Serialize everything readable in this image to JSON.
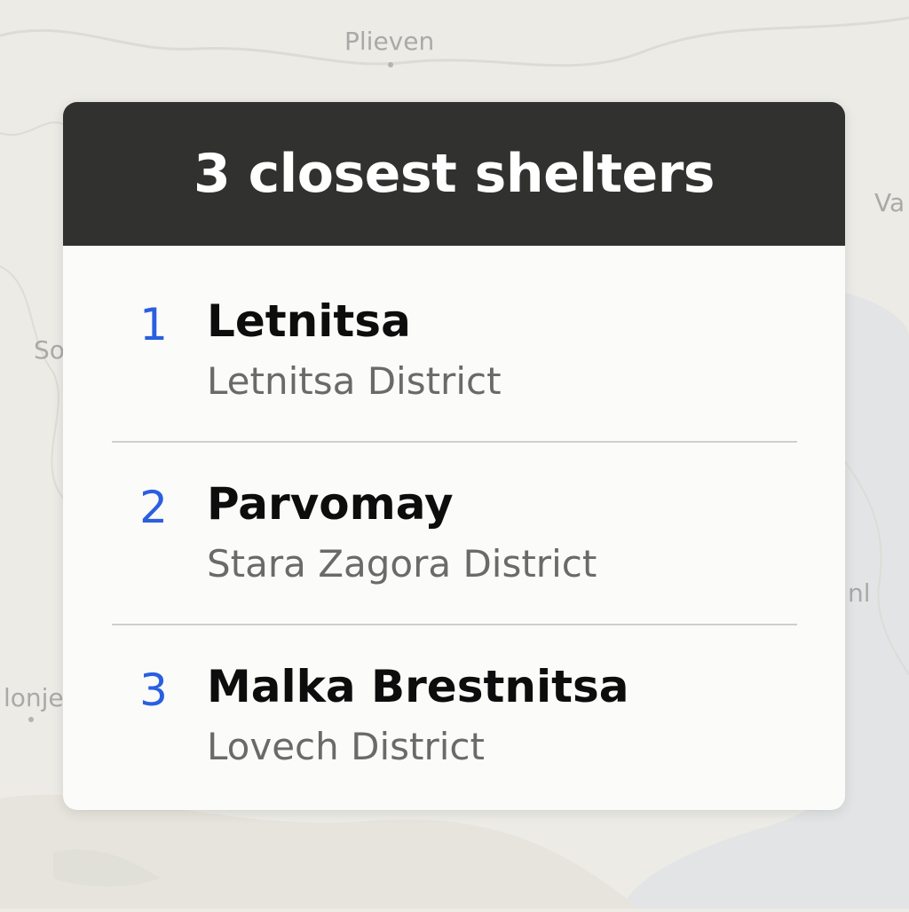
{
  "map": {
    "labels": [
      {
        "name": "map-label-plieven",
        "text": "Plieven"
      },
      {
        "name": "map-label-va",
        "text": "Va"
      },
      {
        "name": "map-label-so",
        "text": "So"
      },
      {
        "name": "map-label-lonje",
        "text": "lonje"
      },
      {
        "name": "map-label-nl",
        "text": "nl"
      }
    ]
  },
  "panel": {
    "title": "3 closest shelters",
    "accent_color": "#2a5fe0",
    "header_color": "#31312f",
    "shelters": [
      {
        "rank": "1",
        "name": "Letnitsa",
        "district": "Letnitsa District"
      },
      {
        "rank": "2",
        "name": "Parvomay",
        "district": "Stara Zagora District"
      },
      {
        "rank": "3",
        "name": "Malka Brestnitsa",
        "district": "Lovech District"
      }
    ]
  }
}
